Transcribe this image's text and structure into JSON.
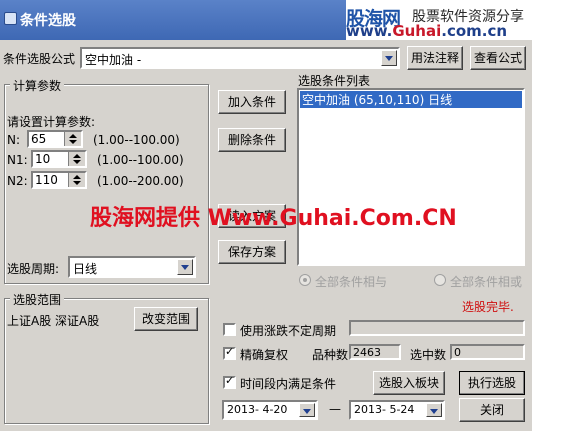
{
  "window": {
    "title": "条件选股"
  },
  "logo": {
    "name": "股海网",
    "slogan": "股票软件资源分享",
    "url_prefix": "www.",
    "url_brand": "Guhai",
    "url_suffix": ".com.cn"
  },
  "formula": {
    "label": "条件选股公式",
    "value": "空中加油 -",
    "help_button": "用法注释",
    "view_button": "查看公式"
  },
  "params": {
    "group_title": "计算参数",
    "prompt": "请设置计算参数:",
    "rows": [
      {
        "label": "N:",
        "value": "65",
        "range": "(1.00--100.00)"
      },
      {
        "label": "N1:",
        "value": "10",
        "range": "(1.00--100.00)"
      },
      {
        "label": "N2:",
        "value": "110",
        "range": "(1.00--200.00)"
      }
    ],
    "period_label": "选股周期:",
    "period_value": "日线"
  },
  "actions": {
    "add": "加入条件",
    "delete": "删除条件",
    "read": "读入方案",
    "save": "保存方案"
  },
  "condition_list": {
    "title": "选股条件列表",
    "items": [
      "空中加油 (65,10,110) 日线"
    ]
  },
  "logic": {
    "all_and": "全部条件相与",
    "all_or": "全部条件相或"
  },
  "status": {
    "text": "选股完毕.",
    "color": "#d01010"
  },
  "range": {
    "group_title": "选股范围",
    "value": "上证A股 深证A股",
    "change_button": "改变范围"
  },
  "options": {
    "uncertain_period": "使用涨跌不定周期",
    "adjust": "精确复权",
    "time_range": "时间段内满足条件"
  },
  "stats": {
    "count_label": "品种数",
    "count_value": "2463",
    "selected_label": "选中数",
    "selected_value": "0"
  },
  "dates": {
    "start": "2013- 4-20",
    "separator": "—",
    "end": "2013- 5-24"
  },
  "buttons": {
    "to_block": "选股入板块",
    "execute": "执行选股",
    "close": "关闭"
  },
  "watermark": "股海网提供 Www.Guhai.Com.CN"
}
